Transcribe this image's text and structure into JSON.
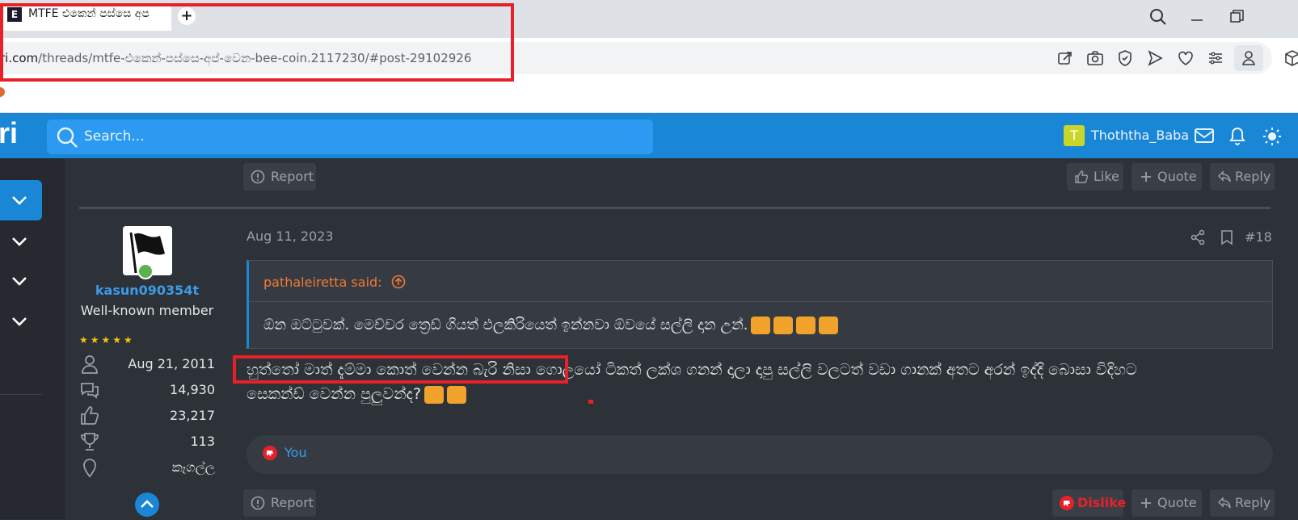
{
  "browser": {
    "tab_title": "MTFE එකෙන් පස්සෙ අප",
    "favicon_text": "E",
    "new_tab_label": "+",
    "url_domain": "ri.com",
    "url_path": "/threads/mtfe-එකෙන්-පස්සෙ-අප්-වෙන-bee-coin.2117230/#post-29102926"
  },
  "header": {
    "logo": "ri",
    "search_placeholder": "Search...",
    "user_initial": "T",
    "username": "Thoththa_Baba",
    "accent": "#1a86d6"
  },
  "prev_post": {
    "report_label": "Report",
    "like_label": "Like",
    "quote_label": "Quote",
    "reply_label": "Reply"
  },
  "post": {
    "date": "Aug 11, 2023",
    "number": "#18",
    "author": {
      "name": "kasun090354t",
      "title": "Well-known member",
      "stars": "★★★★★",
      "stats": [
        {
          "icon": "user-icon",
          "value": "Aug 21, 2011"
        },
        {
          "icon": "messages-icon",
          "value": "14,930"
        },
        {
          "icon": "thumbs-up-icon",
          "value": "23,217"
        },
        {
          "icon": "trophy-icon",
          "value": "113"
        },
        {
          "icon": "location-icon",
          "value": "කෑගල්ල"
        }
      ]
    },
    "quote": {
      "author": "pathaleiretta said:",
      "text": "ඕන ඔට්ටුවක්. මෙච්චර ත්‍රෙඩ් ගියත් එලකිරියෙත් ඉන්නවා ඕවයේ සල්ලි දාන උන්."
    },
    "body_line1_highlight": "හුත්තෝ මාත් දැම්මා කොත් වෙන්න බැරි නිසා",
    "body_line1_rest": " ගොලයෝ ටිකත් ලක්ශ ගනන් දාලා දාපු සල්ලි වලටත් වඩා ගානක් අතට අරන් ඉද්දි බොසා විදිහට",
    "body_line2": "සෙකන්ඩ් වෙන්න පුලුවන්ද?",
    "reaction_you": "You",
    "report_label": "Report",
    "dislike_label": "Dislike",
    "quote_label": "Quote",
    "reply_label": "Reply"
  }
}
